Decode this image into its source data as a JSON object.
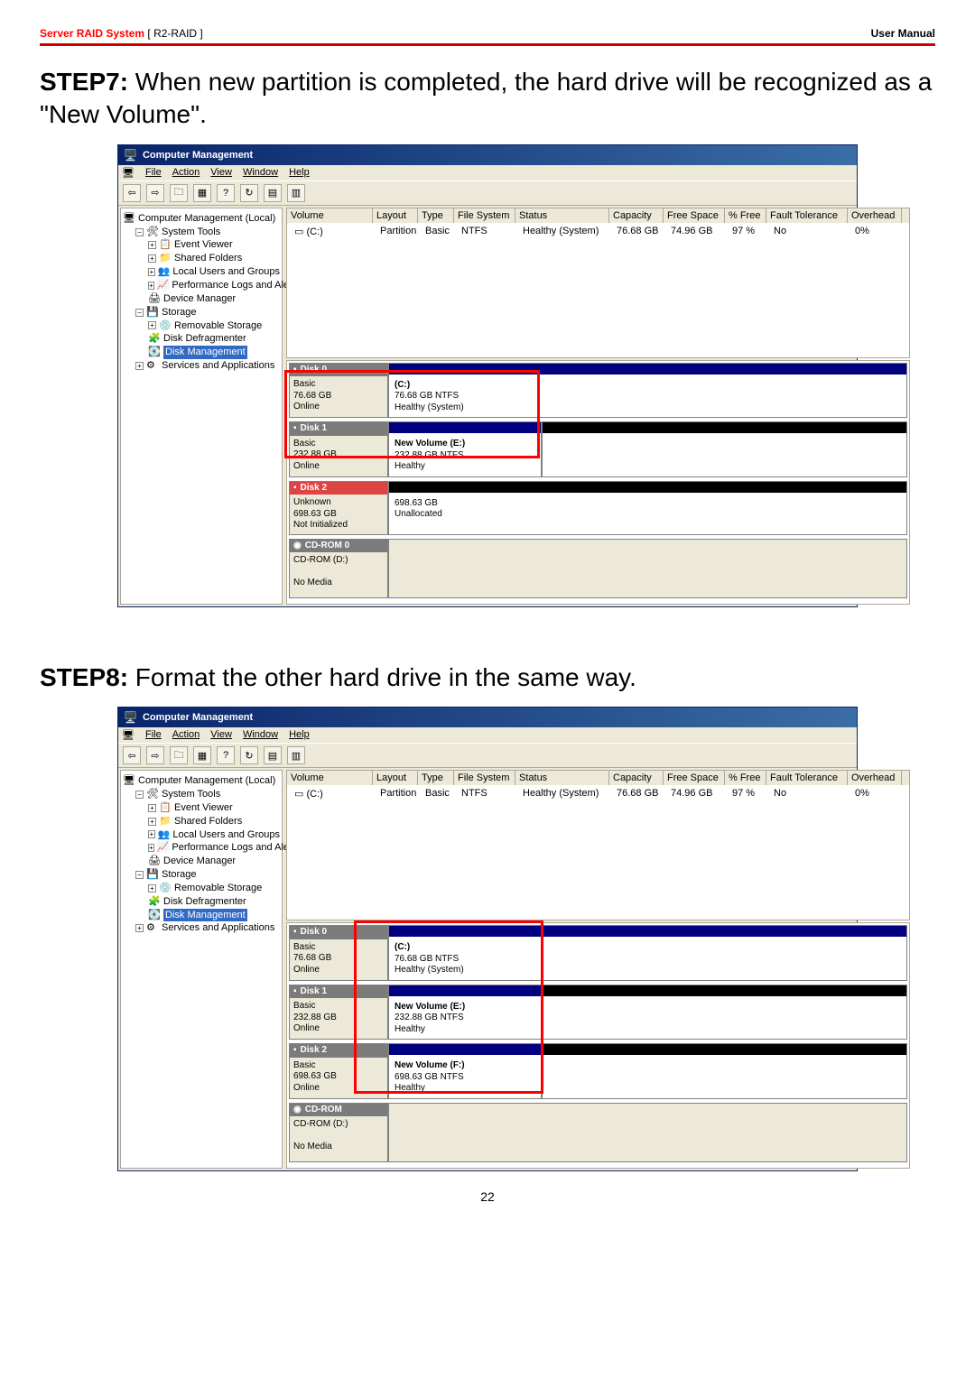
{
  "header": {
    "product": "Server RAID System",
    "sub": " [ R2-RAID ]",
    "right": "User Manual"
  },
  "step7_title_bold": "STEP7:",
  "step7_title_rest": " When new partition is completed, the hard drive will be recognized as a \"New Volume\".",
  "step8_title_bold": "STEP8:",
  "step8_title_rest": " Format the other hard drive in the same way.",
  "window_title": "Computer Management",
  "menu": {
    "file": "File",
    "action": "Action",
    "view": "View",
    "window": "Window",
    "help": "Help"
  },
  "tree": {
    "root": "Computer Management (Local)",
    "system_tools": "System Tools",
    "event_viewer": "Event Viewer",
    "shared_folders": "Shared Folders",
    "local_users": "Local Users and Groups",
    "perf_logs": "Performance Logs and Alerts",
    "device_mgr": "Device Manager",
    "storage": "Storage",
    "removable": "Removable Storage",
    "defrag": "Disk Defragmenter",
    "disk_mgmt": "Disk Management",
    "services": "Services and Applications"
  },
  "vol_headers": {
    "volume": "Volume",
    "layout": "Layout",
    "type": "Type",
    "fs": "File System",
    "status": "Status",
    "capacity": "Capacity",
    "free": "Free Space",
    "pfree": "% Free",
    "ft": "Fault Tolerance",
    "overhead": "Overhead"
  },
  "vol_row": {
    "volume": "(C:)",
    "layout": "Partition",
    "type": "Basic",
    "fs": "NTFS",
    "status": "Healthy (System)",
    "capacity": "76.68 GB",
    "free": "74.96 GB",
    "pfree": "97 %",
    "ft": "No",
    "overhead": "0%"
  },
  "disks7": {
    "d0": {
      "name": "Disk 0",
      "type": "Basic",
      "size": "76.68 GB",
      "state": "Online",
      "part_label": "(C:)",
      "part_fs": "76.68 GB NTFS",
      "part_status": "Healthy (System)"
    },
    "d1": {
      "name": "Disk 1",
      "type": "Basic",
      "size": "232.88 GB",
      "state": "Online",
      "part_label": "New Volume (E:)",
      "part_fs": "232.88 GB NTFS",
      "part_status": "Healthy"
    },
    "d2": {
      "name": "Disk 2",
      "type": "Unknown",
      "size": "698.63 GB",
      "state": "Not Initialized",
      "part_label": "",
      "part_fs": "698.63 GB",
      "part_status": "Unallocated"
    },
    "cd": {
      "name": "CD-ROM 0",
      "sub": "CD-ROM (D:)",
      "empty": "No Media"
    }
  },
  "disks8": {
    "d0": {
      "name": "Disk 0",
      "type": "Basic",
      "size": "76.68 GB",
      "state": "Online",
      "part_label": "(C:)",
      "part_fs": "76.68 GB NTFS",
      "part_status": "Healthy (System)"
    },
    "d1": {
      "name": "Disk 1",
      "type": "Basic",
      "size": "232.88 GB",
      "state": "Online",
      "part_label": "New Volume (E:)",
      "part_fs": "232.88 GB NTFS",
      "part_status": "Healthy"
    },
    "d2": {
      "name": "Disk 2",
      "type": "Basic",
      "size": "698.63 GB",
      "state": "Online",
      "part_label": "New Volume (F:)",
      "part_fs": "698.63 GB NTFS",
      "part_status": "Healthy"
    },
    "cd": {
      "name": "CD-ROM",
      "sub": "CD-ROM (D:)",
      "empty": "No Media"
    }
  },
  "page_no": "22"
}
